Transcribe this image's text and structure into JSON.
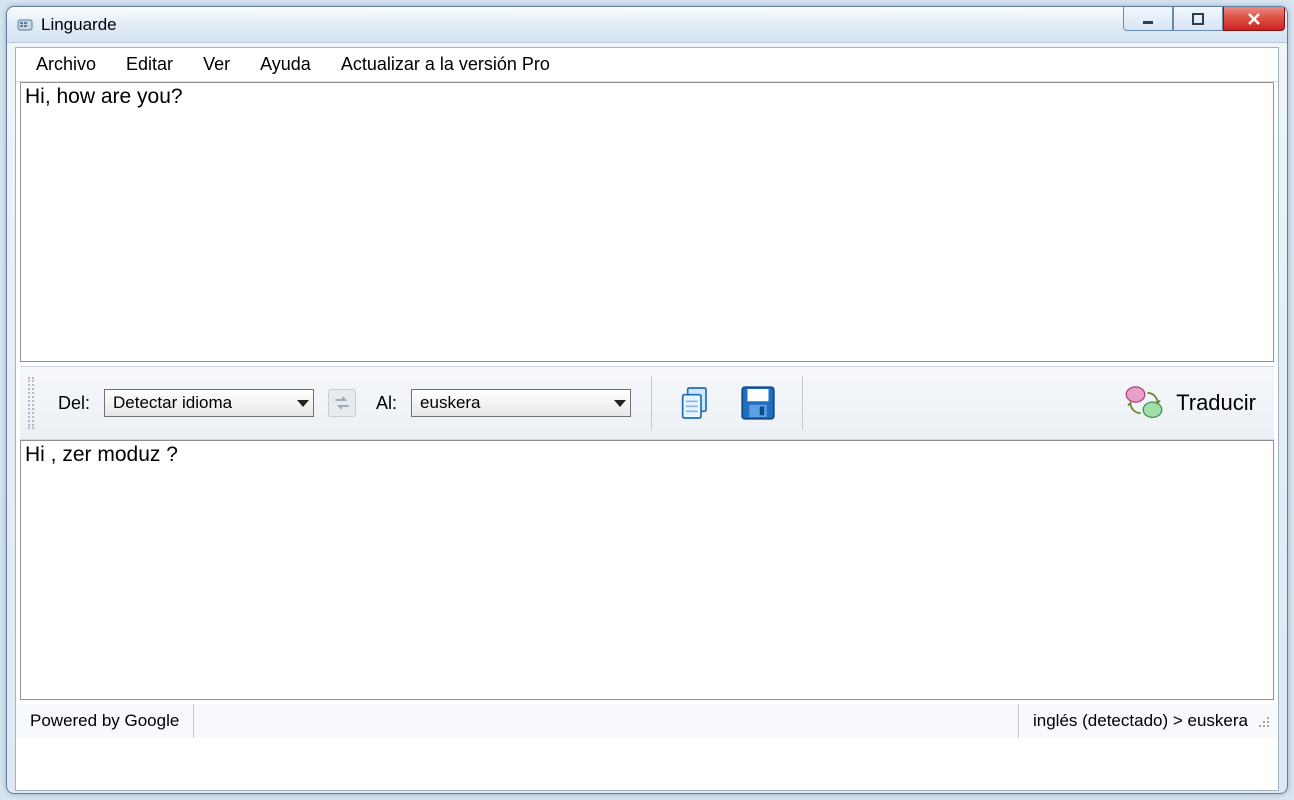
{
  "window": {
    "title": "Linguarde"
  },
  "menu": {
    "items": [
      "Archivo",
      "Editar",
      "Ver",
      "Ayuda",
      "Actualizar a la versión Pro"
    ]
  },
  "source_text": "Hi, how are you?",
  "toolbar": {
    "from_label": "Del:",
    "from_value": "Detectar idioma",
    "to_label": "Al:",
    "to_value": "euskera",
    "translate_label": "Traducir"
  },
  "target_text": "Hi , zer moduz ?",
  "status": {
    "left": "Powered by Google",
    "right": "inglés (detectado) > euskera"
  }
}
